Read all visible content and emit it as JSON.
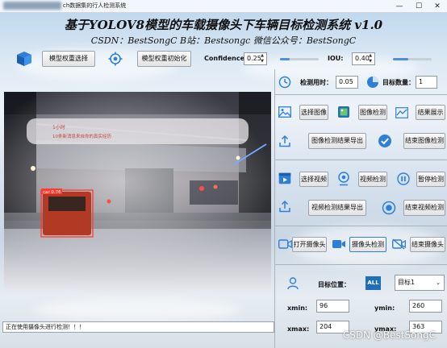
{
  "window": {
    "title_suffix": "ch数据集的行人检测系统",
    "controls": {
      "minimize": "—",
      "maximize": "☐",
      "close": "✕"
    }
  },
  "header": {
    "title": "基于YOLOV8模型的车载摄像头下车辆目标检测系统 v1.0",
    "subtitle": "CSDN：BestSongC   B站：Bestsongc   微信公众号：BestSongC"
  },
  "toolbar": {
    "model_select_label": "模型权重选择",
    "model_init_label": "模型权重初始化",
    "confidence_label": "Confidence:",
    "confidence_value": "0.25",
    "confidence_level": 0.25,
    "iou_label": "IOU:",
    "iou_value": "0.40",
    "iou_level": 0.4
  },
  "stats": {
    "time_label": "检测用时：",
    "time_value": "0.05",
    "count_label": "目标数量：",
    "count_value": "1"
  },
  "image_section": {
    "select_label": "选择图像",
    "detect_label": "图像检测",
    "result_label": "结果展示",
    "export_label": "图像检测结果导出",
    "end_label": "结束图像检测"
  },
  "video_section": {
    "select_label": "选择视频",
    "detect_label": "视频检测",
    "pause_label": "暂停检测",
    "export_label": "视频检测结果导出",
    "end_label": "结束视频检测"
  },
  "camera_section": {
    "open_label": "打开摄像头",
    "detect_label": "摄像头检测",
    "end_label": "结束摄像头"
  },
  "target": {
    "position_label": "目标位置：",
    "all_badge": "ALL",
    "select_value": "目标1",
    "xmin_label": "xmin:",
    "xmin_value": "96",
    "ymin_label": "ymin:",
    "ymin_value": "260",
    "xmax_label": "xmax:",
    "xmax_value": "204",
    "ymax_label": "ymax:",
    "ymax_value": "363"
  },
  "video_overlay": {
    "detection_label": "car 0.76",
    "notification_line1": "1小时",
    "notification_line2": "10条新消息来自你的真实经历"
  },
  "status_bar": {
    "text": "正在使用摄像头进行检测！！！"
  },
  "watermark": "CSDN @BestSongC",
  "colors": {
    "accent": "#2f7fd6",
    "button_border": "#9aa3ad",
    "slider": "#4e8fd8"
  }
}
